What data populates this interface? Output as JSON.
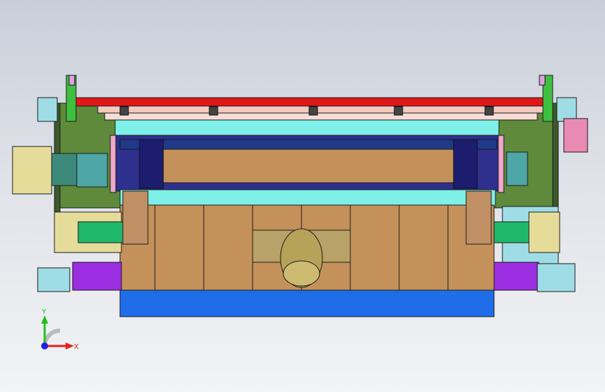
{
  "viewport": {
    "background": "#dfe2e8"
  },
  "model": {
    "colors": {
      "frame_green": "#5f8a3c",
      "frame_dark": "#3b5a2a",
      "rail_red": "#e01818",
      "rail_pink": "#f4c9c0",
      "cyan": "#7ff0e8",
      "tan": "#c4915a",
      "tan_dark": "#a9784a",
      "blue_base": "#1f6de8",
      "navy": "#2a2a8a",
      "purple": "#9b2ee0",
      "light_blue": "#9fdde6",
      "green_block": "#1fb86a",
      "khaki": "#e6dc9a",
      "magenta_box": "#e98ab4",
      "motor_gold": "#b6a259",
      "teal": "#4ea6a6"
    }
  },
  "triad": {
    "x_label": "X",
    "y_label": "Y",
    "x_color": "#e52020",
    "y_color": "#20c020",
    "origin_color": "#2020e0"
  }
}
